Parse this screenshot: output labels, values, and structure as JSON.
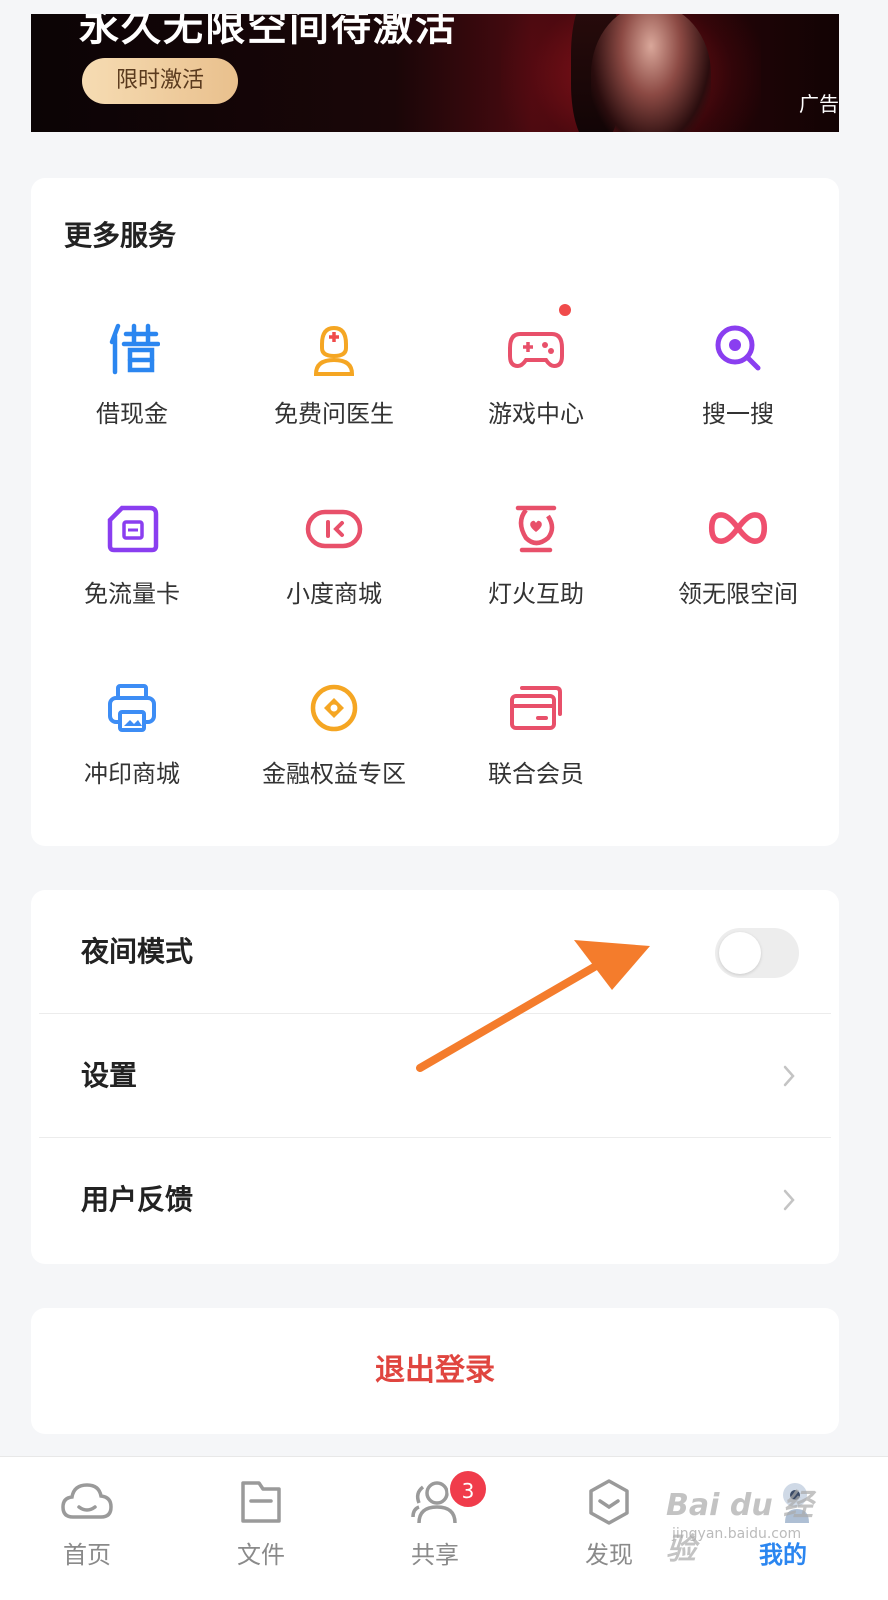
{
  "banner": {
    "title": "永久无限空间待激活",
    "button_label": "限时激活",
    "ad_label": "广告"
  },
  "services": {
    "title": "更多服务",
    "items": [
      {
        "label": "借现金",
        "icon": "jie-char-icon"
      },
      {
        "label": "免费问医生",
        "icon": "doctor-icon"
      },
      {
        "label": "游戏中心",
        "icon": "gamepad-icon"
      },
      {
        "label": "搜一搜",
        "icon": "search-icon"
      },
      {
        "label": "免流量卡",
        "icon": "sim-card-icon"
      },
      {
        "label": "小度商城",
        "icon": "xiaodu-icon"
      },
      {
        "label": "灯火互助",
        "icon": "heart-lamp-icon"
      },
      {
        "label": "领无限空间",
        "icon": "infinity-icon"
      },
      {
        "label": "冲印商城",
        "icon": "printer-icon"
      },
      {
        "label": "金融权益专区",
        "icon": "coin-icon"
      },
      {
        "label": "联合会员",
        "icon": "cards-icon"
      }
    ]
  },
  "settings": {
    "night_mode_label": "夜间模式",
    "night_mode_on": false,
    "settings_label": "设置",
    "feedback_label": "用户反馈"
  },
  "logout_label": "退出登录",
  "nav": {
    "home": "首页",
    "files": "文件",
    "share": "共享",
    "share_badge": "3",
    "discover": "发现",
    "mine": "我的"
  },
  "watermark": {
    "text": "Bai du 经验",
    "url": "jingyan.baidu.com"
  },
  "colors": {
    "accent_blue": "#2b86f0",
    "logout_red": "#e0453f",
    "arrow_orange": "#f47c2c"
  }
}
